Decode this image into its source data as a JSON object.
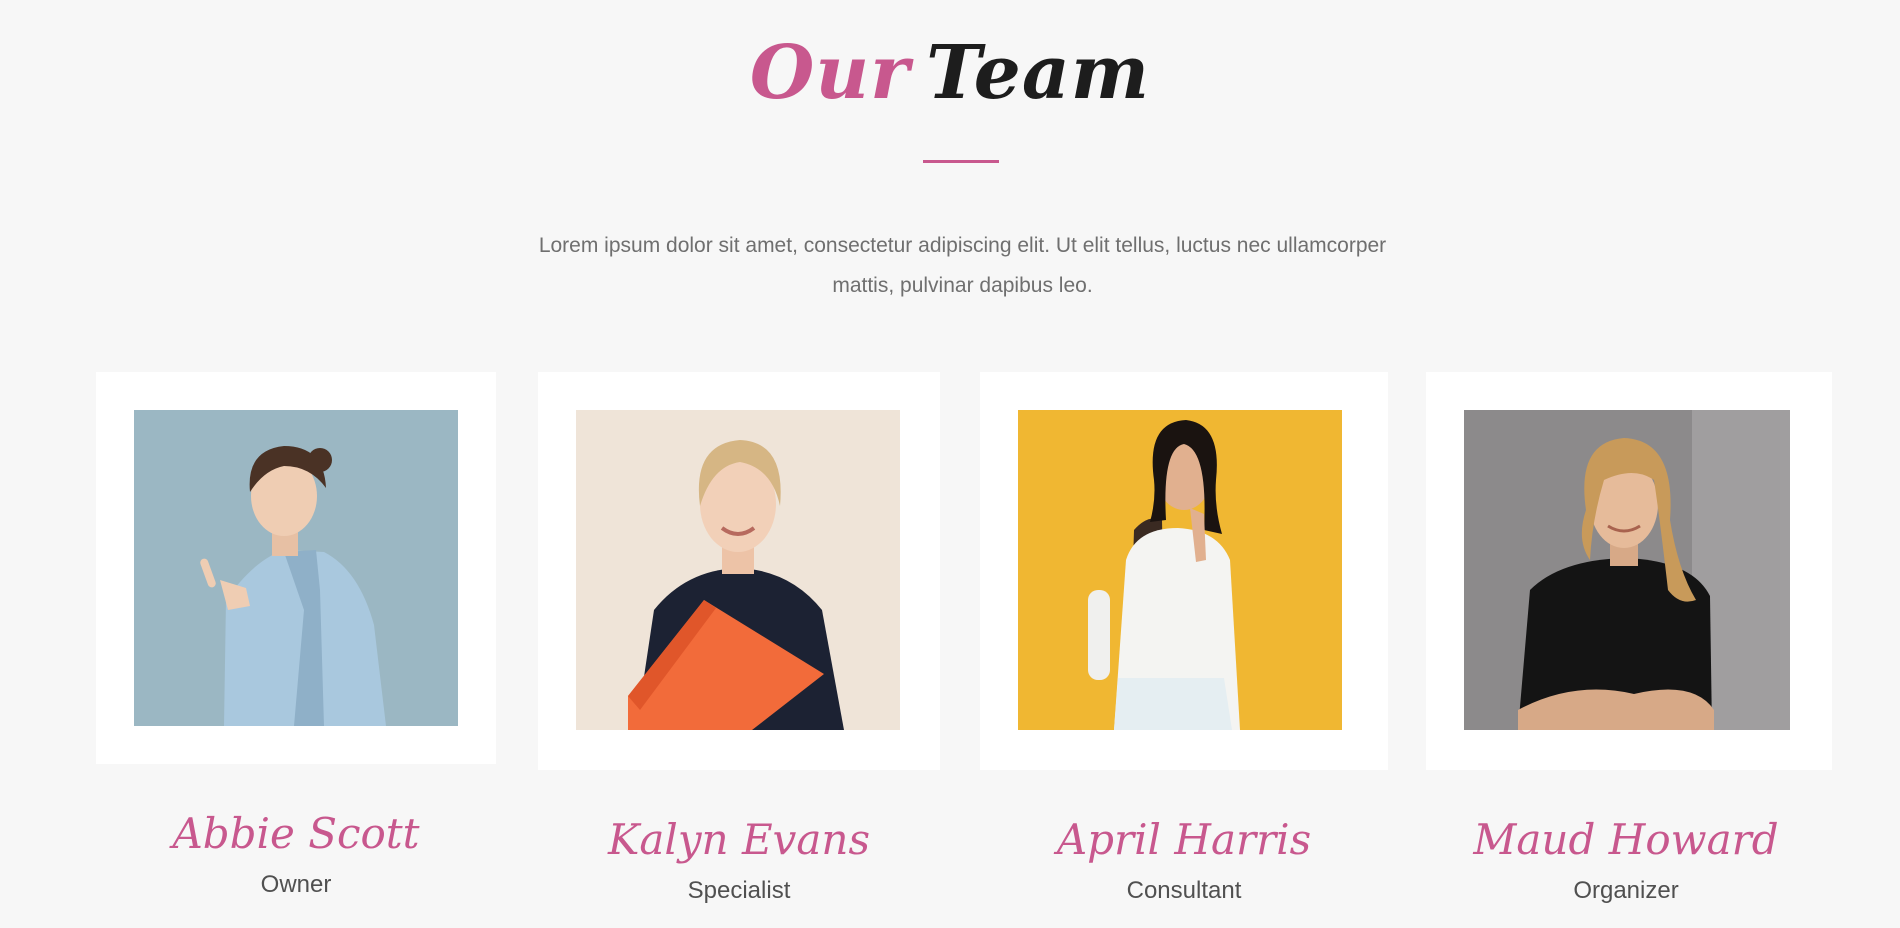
{
  "section": {
    "title_part1": "Our",
    "title_part2": "Team",
    "intro_line1": "Lorem ipsum dolor sit amet, consectetur adipiscing elit. Ut elit tellus, luctus nec ullamcorper",
    "intro_line2": "mattis, pulvinar dapibus leo."
  },
  "colors": {
    "accent": "#c8588e",
    "background": "#f7f7f7",
    "card": "#ffffff"
  },
  "members": [
    {
      "name": "Abbie Scott",
      "role": "Owner",
      "photo_bg": "#9bb7c3",
      "outfit": "#a9c8de"
    },
    {
      "name": "Kalyn Evans",
      "role": "Specialist",
      "photo_bg": "#efe4d8",
      "outfit": "#1c2233"
    },
    {
      "name": "April Harris",
      "role": "Consultant",
      "photo_bg": "#f0b732",
      "outfit": "#f4f4f2"
    },
    {
      "name": "Maud Howard",
      "role": "Organizer",
      "photo_bg": "#8c8a8b",
      "outfit": "#141414"
    }
  ]
}
